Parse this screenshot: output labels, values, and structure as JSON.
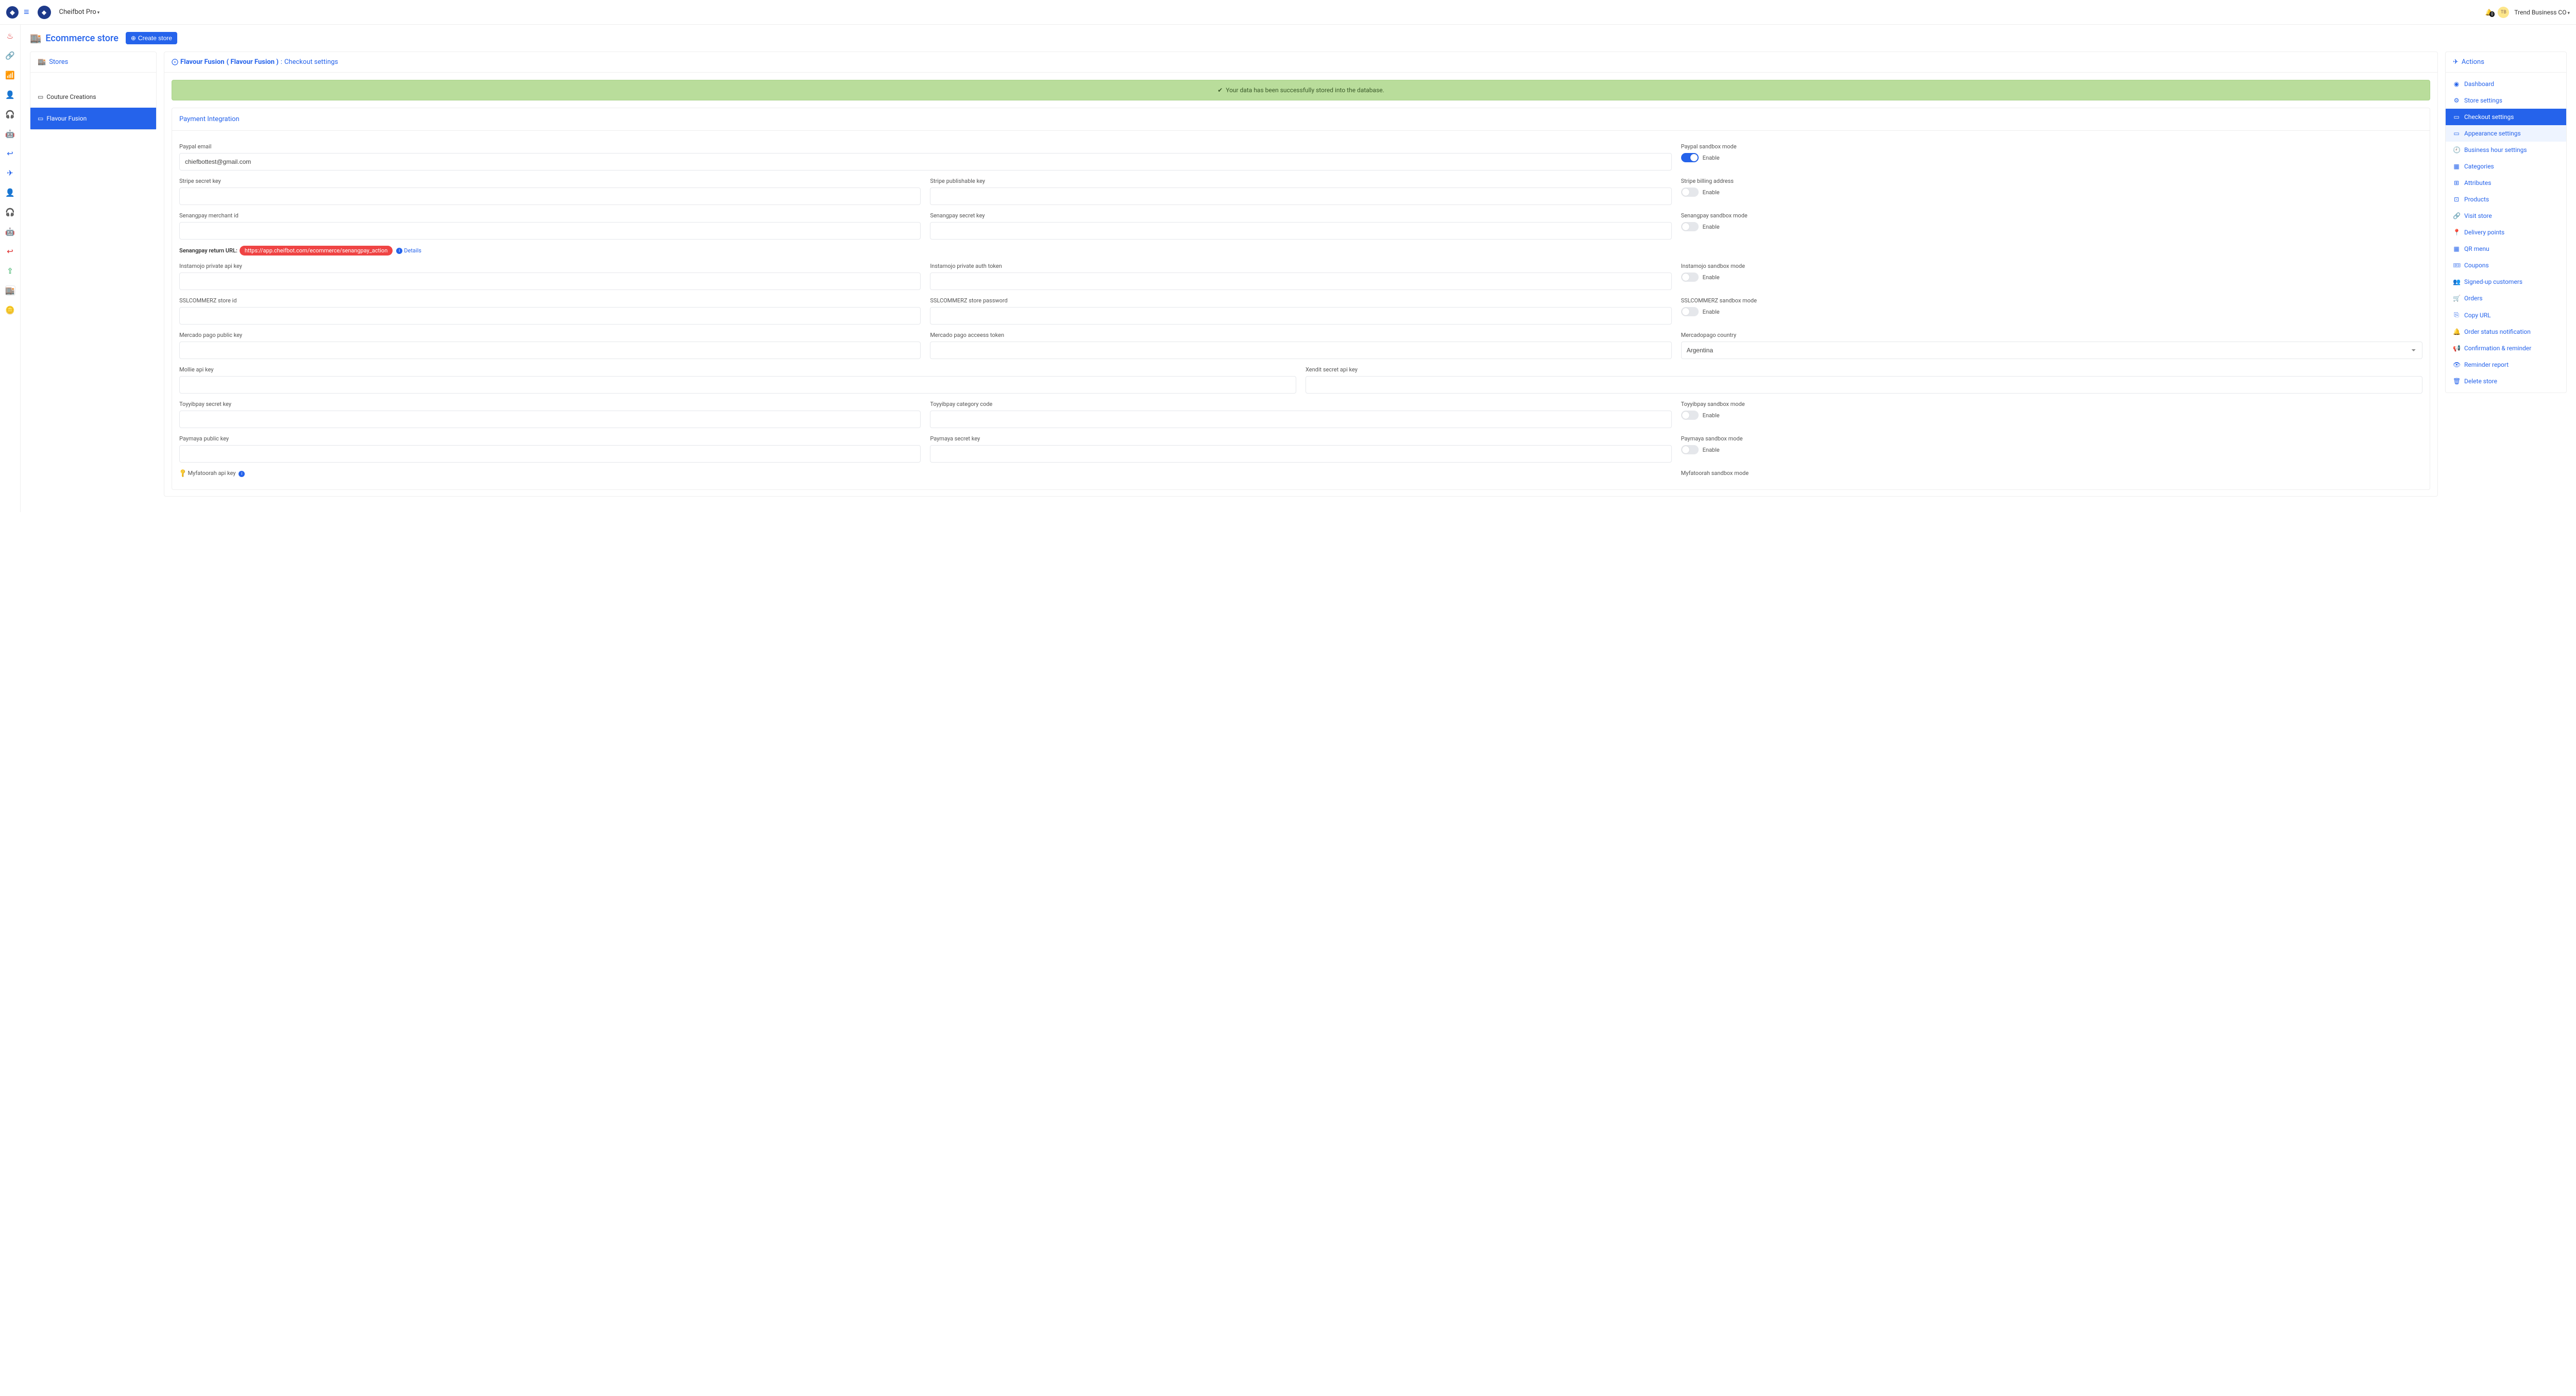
{
  "topbar": {
    "brand": "Cheifbot Pro",
    "notif_count": "0",
    "user_name": "Trend Business CO"
  },
  "page": {
    "title": "Ecommerce store",
    "create_btn": "Create store"
  },
  "stores_panel": {
    "title": "Stores",
    "items": [
      "Couture Creations",
      "Flavour Fusion"
    ],
    "active_index": 1
  },
  "breadcrumb": {
    "store": "Flavour Fusion",
    "paren": "( Flavour Fusion )",
    "sep": ":",
    "page": "Checkout settings"
  },
  "alert": "Your data has been successfully stored into the database.",
  "section_title": "Payment Integration",
  "labels": {
    "paypal_email": "Paypal email",
    "paypal_sandbox": "Paypal sandbox mode",
    "stripe_secret": "Stripe secret key",
    "stripe_pub": "Stripe publishable key",
    "stripe_billing": "Stripe billing address",
    "senang_merchant": "Senangpay merchant id",
    "senang_secret": "Senangpay secret key",
    "senang_sandbox": "Senangpay sandbox mode",
    "senang_return_label": "Senangpay return URL:",
    "senang_return_url": "https://app.cheifbot.com/ecommerce/senangpay_action",
    "details": "Details",
    "insta_private": "Instamojo private api key",
    "insta_auth": "Instamojo private auth token",
    "insta_sandbox": "Instamojo sandbox mode",
    "ssl_store": "SSLCOMMERZ store id",
    "ssl_pass": "SSLCOMMERZ store password",
    "ssl_sandbox": "SSLCOMMERZ sandbox mode",
    "mp_public": "Mercado pago public key",
    "mp_token": "Mercado pago acceess token",
    "mp_country": "Mercadopago country",
    "mollie": "Mollie api key",
    "xendit": "Xendit secret api key",
    "toyyib_secret": "Toyyibpay secret key",
    "toyyib_cat": "Toyyibpay category code",
    "toyyib_sandbox": "Toyyibpay sandbox mode",
    "paymaya_pub": "Paymaya public key",
    "paymaya_secret": "Paymaya secret key",
    "paymaya_sandbox": "Paymaya sandbox mode",
    "myfatoorah": "Myfatoorah api key",
    "myfatoorah_sandbox": "Myfatoorah sandbox mode",
    "enable": "Enable"
  },
  "values": {
    "paypal_email": "chiefbottest@gmail.com",
    "mp_country": "Argentina"
  },
  "toggles": {
    "paypal_sandbox": true,
    "stripe_billing": false,
    "senang_sandbox": false,
    "insta_sandbox": false,
    "ssl_sandbox": false,
    "toyyib_sandbox": false,
    "paymaya_sandbox": false
  },
  "actions_panel": {
    "title": "Actions",
    "items": [
      {
        "icon": "◉",
        "label": "Dashboard"
      },
      {
        "icon": "⚙",
        "label": "Store settings"
      },
      {
        "icon": "▭",
        "label": "Checkout settings",
        "active": true
      },
      {
        "icon": "▭",
        "label": "Appearance settings",
        "hover": true
      },
      {
        "icon": "🕘",
        "label": "Business hour settings"
      },
      {
        "icon": "▦",
        "label": "Categories"
      },
      {
        "icon": "⊞",
        "label": "Attributes"
      },
      {
        "icon": "⊡",
        "label": "Products"
      },
      {
        "icon": "🔗",
        "label": "Visit store"
      },
      {
        "icon": "📍",
        "label": "Delivery points"
      },
      {
        "icon": "▦",
        "label": "QR menu"
      },
      {
        "icon": "🎟",
        "label": "Coupons"
      },
      {
        "icon": "👥",
        "label": "Signed-up customers"
      },
      {
        "icon": "🛒",
        "label": "Orders"
      },
      {
        "icon": "⎘",
        "label": "Copy URL"
      },
      {
        "icon": "🔔",
        "label": "Order status notification"
      },
      {
        "icon": "📢",
        "label": "Confirmation & reminder"
      },
      {
        "icon": "👁",
        "label": "Reminder report"
      },
      {
        "icon": "🗑",
        "label": "Delete store"
      }
    ]
  }
}
